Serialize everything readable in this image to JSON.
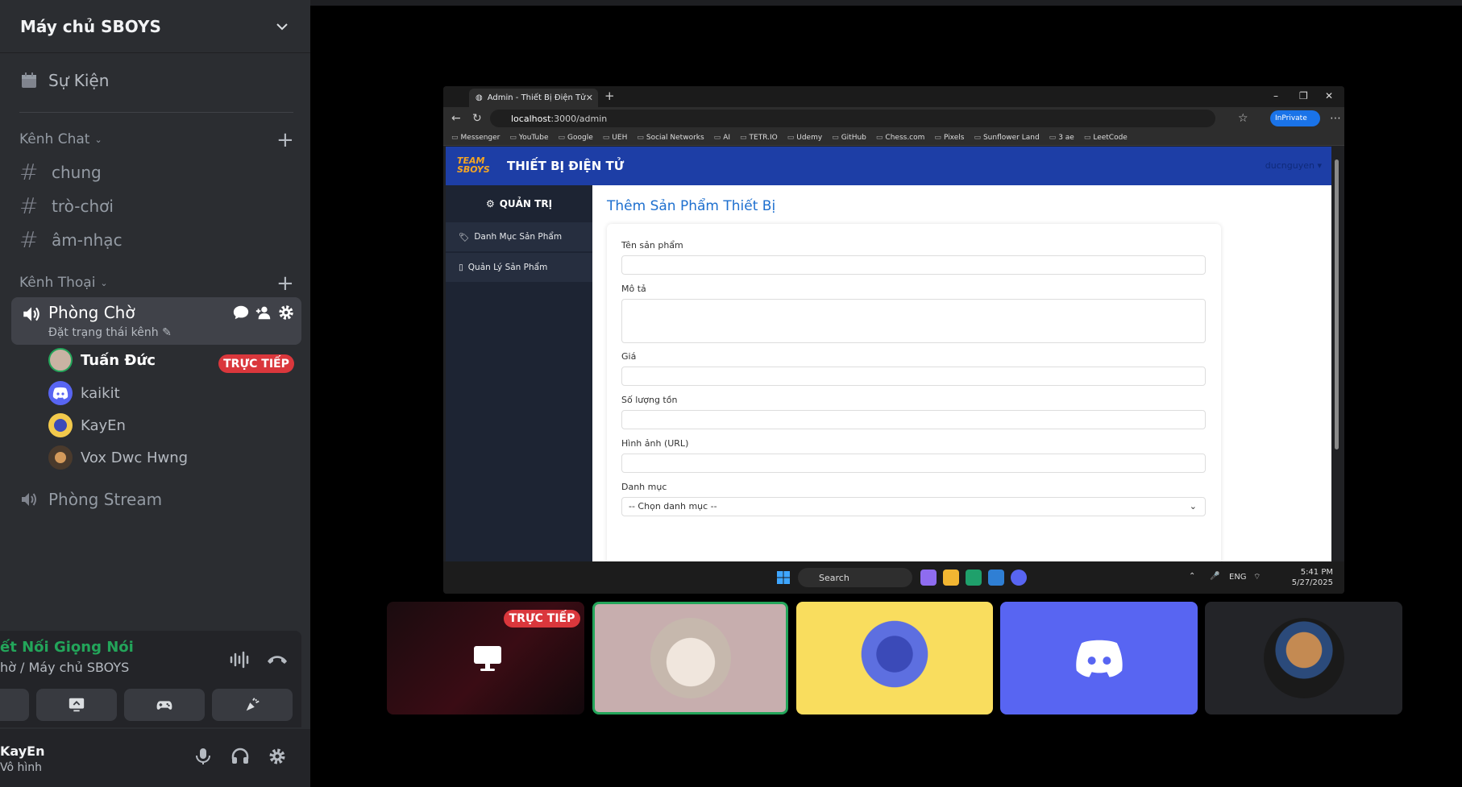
{
  "sidebar": {
    "server_name": "Máy chủ SBOYS",
    "events_label": "Sự Kiện",
    "text_category": "Kênh Chat",
    "text_channels": [
      "chung",
      "trò-chơi",
      "âm-nhạc"
    ],
    "voice_category": "Kênh Thoại",
    "active_voice_channel": "Phòng Chờ",
    "voice_status_placeholder": "Đặt trạng thái kênh",
    "members": [
      {
        "name": "Tuấn Đức"
      },
      {
        "name": "kaikit"
      },
      {
        "name": "KayEn"
      },
      {
        "name": "Vox Dwc Hwng"
      }
    ],
    "live_badge": "TRỰC TIẾP",
    "other_voice_channel": "Phòng Stream",
    "voice_panel": {
      "connected_label": "ết Nối Giọng Nói",
      "location": "hờ / Máy chủ SBOYS"
    },
    "user": {
      "name": "KayEn",
      "status": "Vô hình"
    }
  },
  "browser": {
    "tab_title": "Admin - Thiết Bị Điện Tử",
    "url_host": "localhost",
    "url_path": ":3000/admin",
    "inprivate_label": "InPrivate",
    "bookmarks": [
      "Messenger",
      "YouTube",
      "Google",
      "UEH",
      "Social Networks",
      "AI",
      "TETR.IO",
      "Udemy",
      "GitHub",
      "Chess.com",
      "Pixels",
      "Sunflower Land",
      "3 ae",
      "LeetCode"
    ]
  },
  "admin": {
    "brand_logo": "TEAM SBOYS",
    "brand_title": "THIẾT BỊ ĐIỆN TỬ",
    "user_menu": "ducnguyen ▾",
    "side_header": "QUẢN TRỊ",
    "side_items": [
      "Danh Mục Sản Phẩm",
      "Quản Lý Sản Phẩm"
    ],
    "page_title": "Thêm Sản Phẩm Thiết Bị",
    "form": {
      "name_label": "Tên sản phẩm",
      "desc_label": "Mô tả",
      "price_label": "Giá",
      "stock_label": "Số lượng tồn",
      "image_label": "Hình ảnh (URL)",
      "category_label": "Danh mục",
      "category_select": "-- Chọn danh mục --"
    }
  },
  "taskbar": {
    "search_label": "Search",
    "lang": "ENG",
    "time": "5:41 PM",
    "date": "5/27/2025"
  },
  "tiles": {
    "live_badge": "TRỰC TIẾP"
  },
  "colors": {
    "discord_bg": "#2b2d31",
    "live_red": "#da373c",
    "connected_green": "#23a55a",
    "blurple": "#5865f2",
    "admin_blue": "#1d3ea6"
  }
}
